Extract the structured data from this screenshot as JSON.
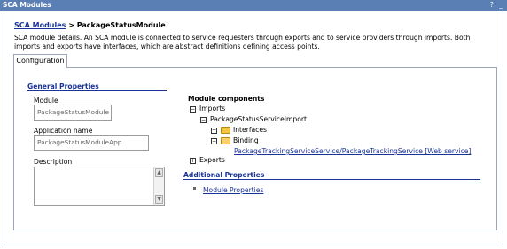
{
  "window": {
    "title": "SCA Modules",
    "buttons": "? _"
  },
  "breadcrumb": {
    "link": "SCA Modules",
    "separator": ">",
    "current": "PackageStatusModule"
  },
  "description": "SCA module details. An SCA module is connected to service requesters through exports and to service providers through imports. Both imports and exports have interfaces, which are abstract definitions defining access points.",
  "tabs": [
    {
      "label": "Configuration"
    }
  ],
  "general": {
    "heading": "General Properties",
    "module_label": "Module",
    "module_value": "PackageStatusModule",
    "app_label": "Application name",
    "app_value": "PackageStatusModuleApp",
    "description_label": "Description"
  },
  "components": {
    "heading": "Module components",
    "imports": "Imports",
    "import_name": "PackageStatusServiceImport",
    "interfaces": "Interfaces",
    "binding": "Binding",
    "binding_link": "PackageTrackingServiceService/PackageTrackingService [Web service]",
    "exports": "Exports"
  },
  "additional": {
    "heading": "Additional Properties",
    "module_properties": "Module Properties"
  },
  "colors": {
    "titlebar": "#5a7fb5",
    "link": "#1a3399",
    "border": "#9aa6b8"
  }
}
